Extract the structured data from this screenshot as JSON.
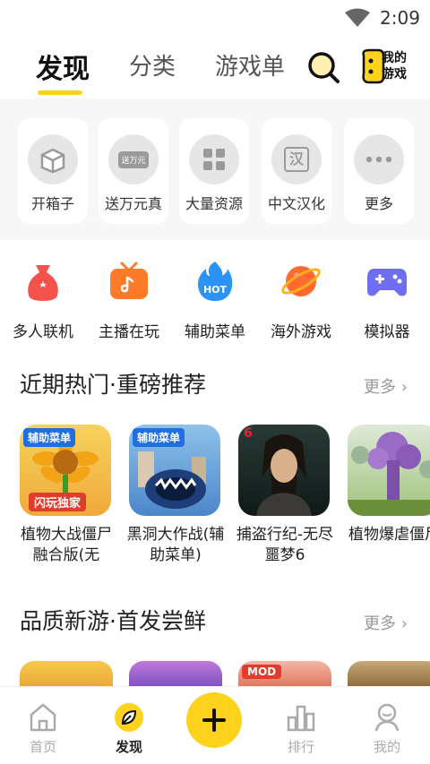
{
  "status_bar": {
    "time": "2:09",
    "wifi_icon": "wifi-icon"
  },
  "top_nav": {
    "tabs": [
      {
        "label": "发现",
        "active": true
      },
      {
        "label": "分类",
        "active": false
      },
      {
        "label": "游戏单",
        "active": false
      }
    ],
    "search_icon": "search-icon",
    "my_games_label_line1": "我的",
    "my_games_label_line2": "游戏"
  },
  "quick_links": [
    {
      "label": "开箱子",
      "icon": "box-icon"
    },
    {
      "label": "送万元真",
      "icon": "gift-icon",
      "icon_text": "送万元"
    },
    {
      "label": "大量资源",
      "icon": "grid-icon"
    },
    {
      "label": "中文汉化",
      "icon": "chinese-icon",
      "icon_text": "汉"
    },
    {
      "label": "更多",
      "icon": "more-dots-icon"
    }
  ],
  "categories": [
    {
      "label": "多人联机",
      "icon": "bag-icon",
      "color": "#f4524b"
    },
    {
      "label": "主播在玩",
      "icon": "tv-icon",
      "color": "#ff7b2a"
    },
    {
      "label": "辅助菜单",
      "icon": "hot-flame-icon",
      "color": "#2a93f5",
      "icon_text": "HOT"
    },
    {
      "label": "海外游戏",
      "icon": "planet-icon",
      "color": "#ff6a2e"
    },
    {
      "label": "模拟器",
      "icon": "gamepad-icon",
      "color": "#6f6df2"
    }
  ],
  "section_hot": {
    "title": "近期热门·重磅推荐",
    "more": "更多",
    "games": [
      {
        "name": "植物大战僵尸融合版(无",
        "badge": "辅助菜单",
        "banner": "闪玩独家"
      },
      {
        "name": "黑洞大作战(辅助菜单)",
        "badge": "辅助菜单"
      },
      {
        "name": "捕盗行纪-无尽噩梦6",
        "corner": "6"
      },
      {
        "name": "植物爆虐僵尸"
      }
    ]
  },
  "section_new": {
    "title": "品质新游·首发尝鲜",
    "more": "更多",
    "first_badge": "MOD"
  },
  "bottom_nav": [
    {
      "label": "首页",
      "icon": "home-icon",
      "active": false
    },
    {
      "label": "发现",
      "icon": "discover-leaf-icon",
      "active": true
    },
    {
      "label": "",
      "icon": "plus-icon",
      "active": false
    },
    {
      "label": "排行",
      "icon": "ranking-icon",
      "active": false
    },
    {
      "label": "我的",
      "icon": "profile-icon",
      "active": false
    }
  ],
  "colors": {
    "accent": "#ffd21e",
    "text": "#222222",
    "muted": "#999999"
  }
}
